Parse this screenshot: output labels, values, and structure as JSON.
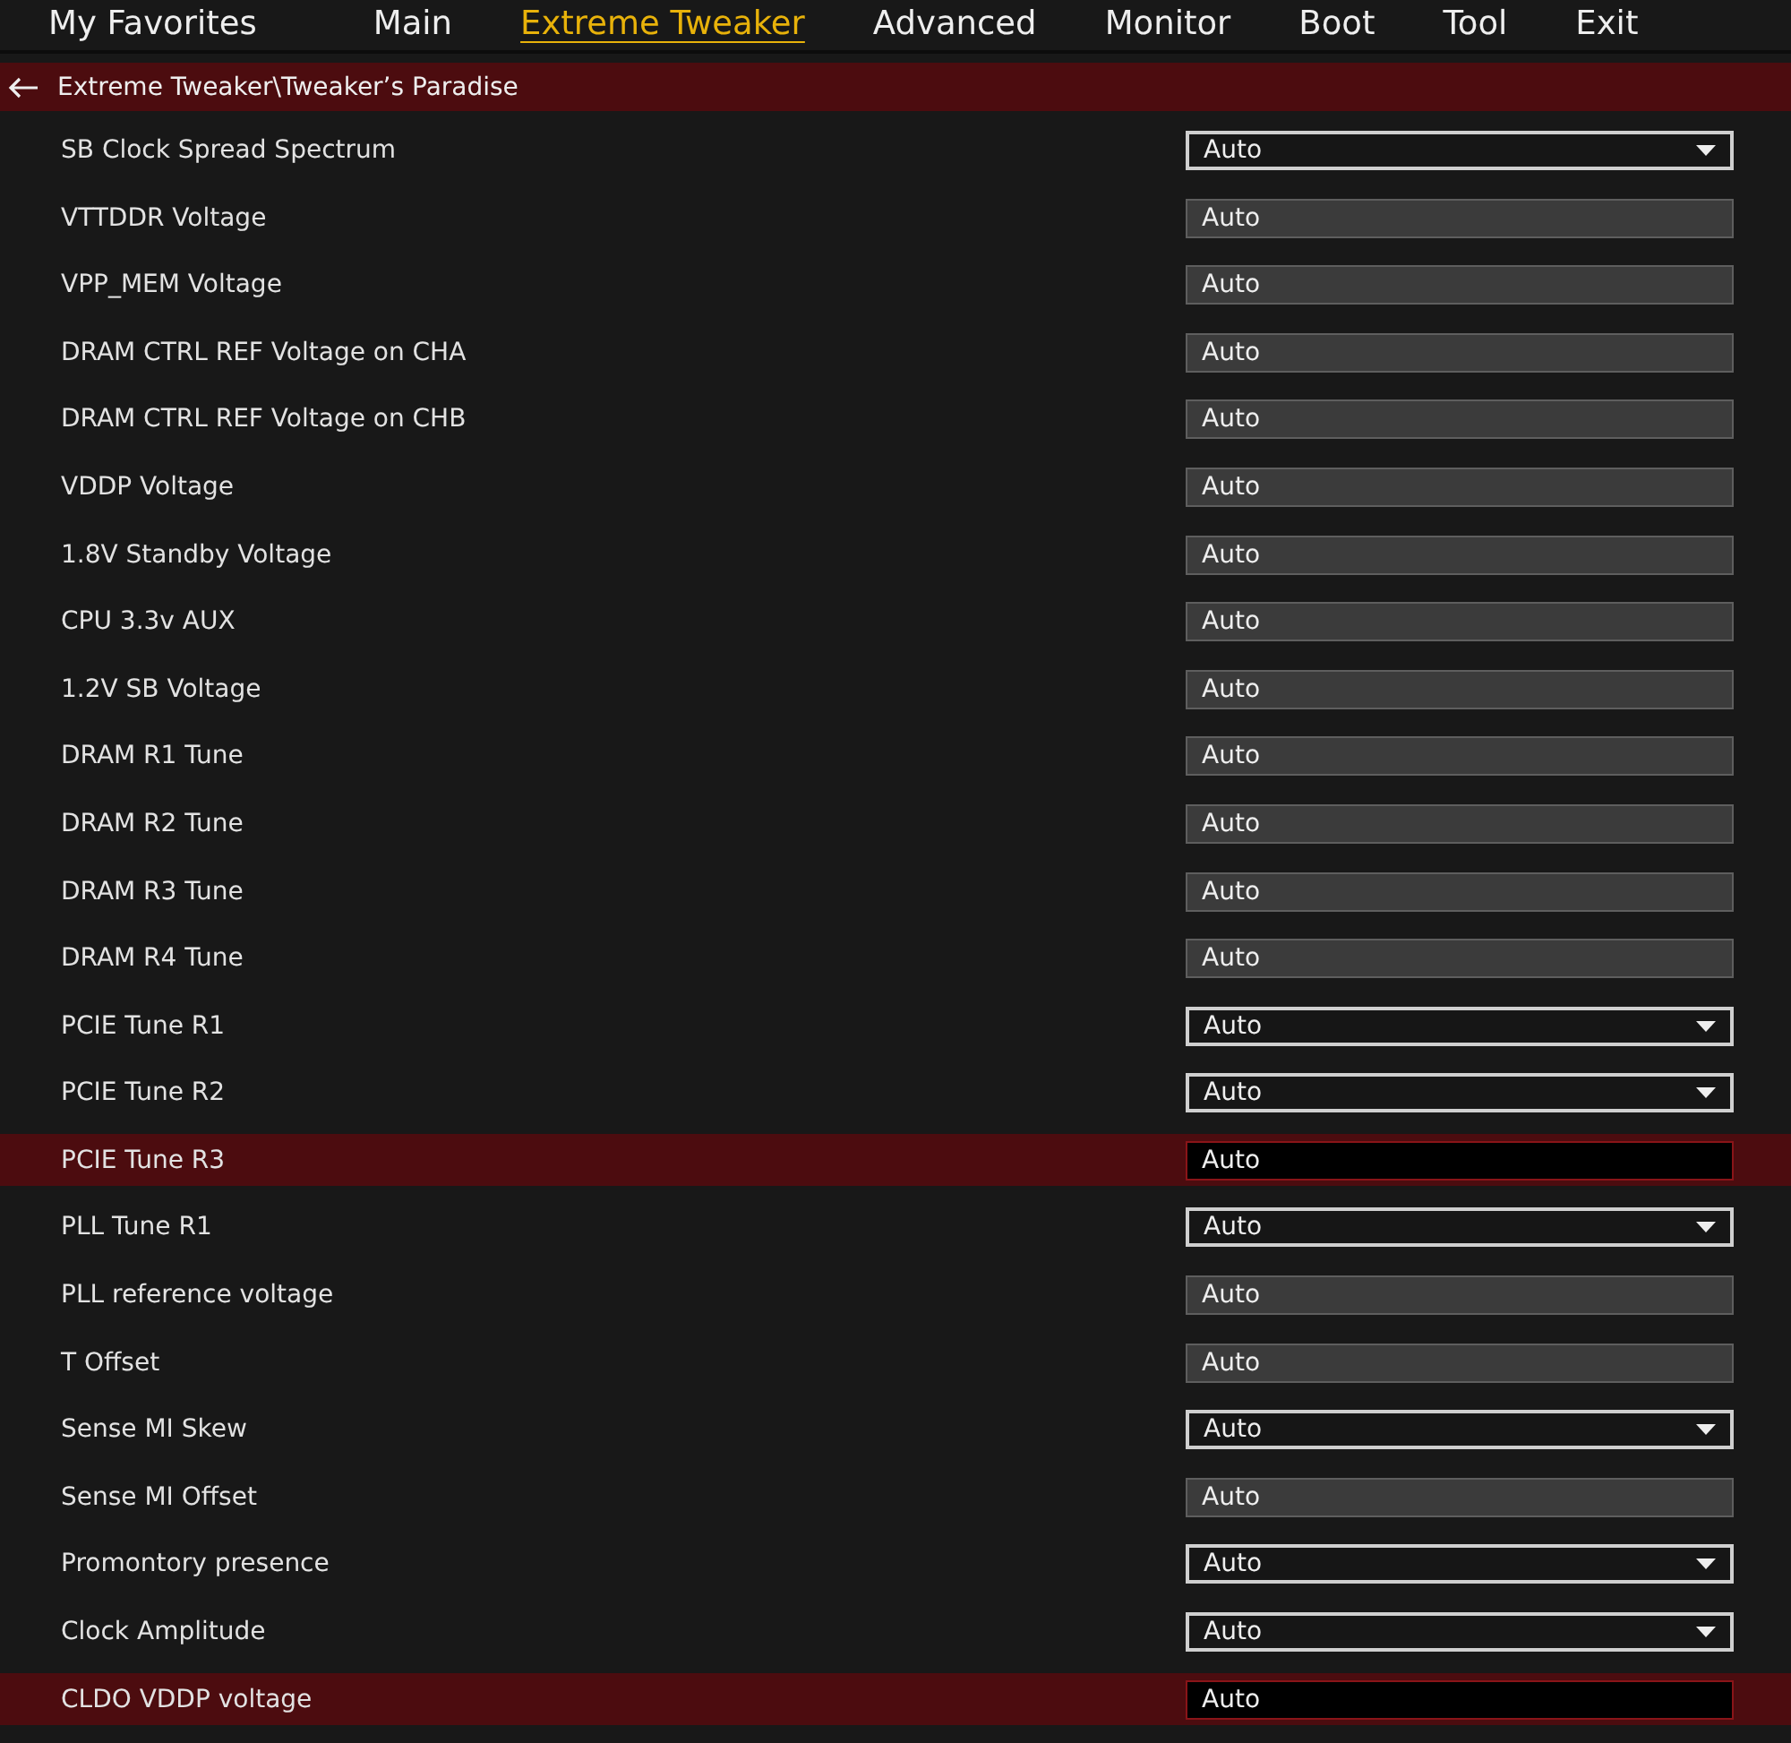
{
  "tabs": [
    {
      "label": "My Favorites",
      "selected": false
    },
    {
      "label": "Main",
      "selected": false
    },
    {
      "label": "Extreme Tweaker",
      "selected": true
    },
    {
      "label": "Advanced",
      "selected": false
    },
    {
      "label": "Monitor",
      "selected": false
    },
    {
      "label": "Boot",
      "selected": false
    },
    {
      "label": "Tool",
      "selected": false
    },
    {
      "label": "Exit",
      "selected": false
    }
  ],
  "breadcrumb": {
    "path": "Extreme Tweaker\\Tweaker’s Paradise"
  },
  "settings": [
    {
      "label": "SB Clock Spread Spectrum",
      "kind": "dropdown",
      "value": "Auto",
      "selected": false
    },
    {
      "label": "VTTDDR Voltage",
      "kind": "field",
      "value": "Auto",
      "selected": false
    },
    {
      "label": "VPP_MEM Voltage",
      "kind": "field",
      "value": "Auto",
      "selected": false
    },
    {
      "label": "DRAM CTRL REF Voltage on CHA",
      "kind": "field",
      "value": "Auto",
      "selected": false
    },
    {
      "label": "DRAM CTRL REF Voltage on CHB",
      "kind": "field",
      "value": "Auto",
      "selected": false
    },
    {
      "label": "VDDP Voltage",
      "kind": "field",
      "value": "Auto",
      "selected": false
    },
    {
      "label": "1.8V Standby Voltage",
      "kind": "field",
      "value": "Auto",
      "selected": false
    },
    {
      "label": "CPU 3.3v AUX",
      "kind": "field",
      "value": "Auto",
      "selected": false
    },
    {
      "label": "1.2V SB Voltage",
      "kind": "field",
      "value": "Auto",
      "selected": false
    },
    {
      "label": "DRAM R1 Tune",
      "kind": "field",
      "value": "Auto",
      "selected": false
    },
    {
      "label": "DRAM R2 Tune",
      "kind": "field",
      "value": "Auto",
      "selected": false
    },
    {
      "label": "DRAM R3 Tune",
      "kind": "field",
      "value": "Auto",
      "selected": false
    },
    {
      "label": "DRAM R4 Tune",
      "kind": "field",
      "value": "Auto",
      "selected": false
    },
    {
      "label": "PCIE Tune R1",
      "kind": "dropdown",
      "value": "Auto",
      "selected": false
    },
    {
      "label": "PCIE Tune R2",
      "kind": "dropdown",
      "value": "Auto",
      "selected": false
    },
    {
      "label": "PCIE Tune R3",
      "kind": "field",
      "value": "Auto",
      "selected": true
    },
    {
      "label": "PLL Tune R1",
      "kind": "dropdown",
      "value": "Auto",
      "selected": false
    },
    {
      "label": "PLL reference voltage",
      "kind": "field",
      "value": "Auto",
      "selected": false
    },
    {
      "label": "T Offset",
      "kind": "field",
      "value": "Auto",
      "selected": false
    },
    {
      "label": "Sense MI Skew",
      "kind": "dropdown",
      "value": "Auto",
      "selected": false
    },
    {
      "label": "Sense MI Offset",
      "kind": "field",
      "value": "Auto",
      "selected": false
    },
    {
      "label": "Promontory presence",
      "kind": "dropdown",
      "value": "Auto",
      "selected": false
    },
    {
      "label": "Clock Amplitude",
      "kind": "dropdown",
      "value": "Auto",
      "selected": false
    },
    {
      "label": "CLDO VDDP voltage",
      "kind": "field",
      "value": "Auto",
      "selected": true
    }
  ]
}
